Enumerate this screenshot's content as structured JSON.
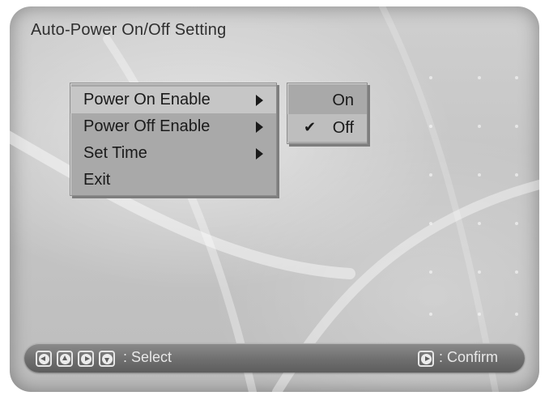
{
  "window": {
    "title": "Auto-Power On/Off Setting"
  },
  "menu": {
    "items": [
      {
        "label": "Power On Enable",
        "has_submenu": true,
        "active": true
      },
      {
        "label": "Power Off Enable",
        "has_submenu": true,
        "active": false
      },
      {
        "label": "Set Time",
        "has_submenu": true,
        "active": false
      },
      {
        "label": "Exit",
        "has_submenu": false,
        "active": false
      }
    ]
  },
  "submenu": {
    "options": [
      {
        "label": "On",
        "checked": false
      },
      {
        "label": "Off",
        "checked": true
      }
    ],
    "check_glyph": "✔"
  },
  "footer": {
    "nav_icons": [
      "left-arrow-icon",
      "up-arrow-icon",
      "right-arrow-icon",
      "down-arrow-icon"
    ],
    "select_label": ": Select",
    "confirm_icon": "play-icon",
    "confirm_label": ": Confirm"
  },
  "colors": {
    "menu_background": "#a9a9a9",
    "menu_highlight": "#c6c6c6",
    "footer_bar": "#6f6f6f",
    "footer_text": "#e8e8e8"
  }
}
